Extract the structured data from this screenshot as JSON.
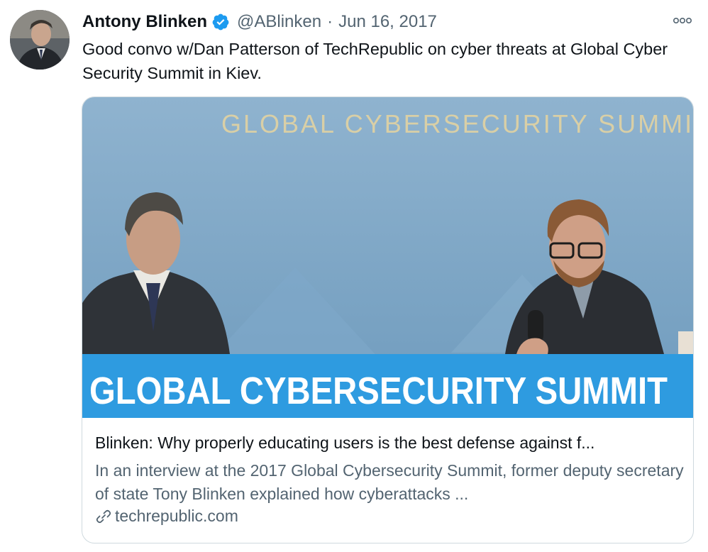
{
  "tweet": {
    "author_name": "Antony Blinken",
    "handle": "@ABlinken",
    "separator": "·",
    "date": "Jun 16, 2017",
    "text": "Good convo w/Dan Patterson of TechRepublic on cyber threats at Global Cyber Security Summit in Kiev."
  },
  "icons": {
    "verified": "verified-badge-icon",
    "more": "more-options-icon",
    "link": "link-icon"
  },
  "card": {
    "image": {
      "backdrop_text": "GLOBAL CYBERSECURITY SUMMIT",
      "banner_text": "GLOBAL CYBERSECURITY SUMMIT"
    },
    "title": "Blinken: Why properly educating users is the best defense against f...",
    "description": "In an interview at the 2017 Global Cybersecurity Summit, former deputy secretary of state Tony Blinken explained how cyberattacks ...",
    "domain": "techrepublic.com"
  },
  "colors": {
    "name": "#0f1419",
    "secondary": "#536471",
    "verified": "#1d9bf0",
    "banner": "#2e9be0",
    "backdrop": "#7ea6c6"
  }
}
